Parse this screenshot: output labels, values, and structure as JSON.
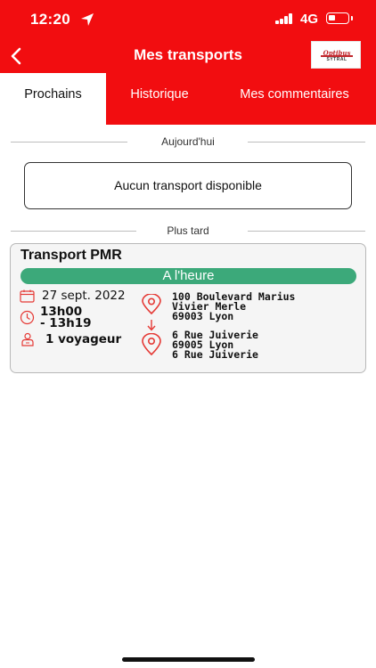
{
  "status_bar": {
    "time": "12:20",
    "network": "4G",
    "battery_level": 0.35,
    "location_icon": "location-arrow-icon",
    "signal_icon": "signal-bars-icon",
    "battery_icon": "battery-icon"
  },
  "header": {
    "title": "Mes transports",
    "back_icon": "chevron-left-icon",
    "logo_text": "Optibus",
    "logo_subtext": "SYTRAL"
  },
  "tabs": [
    {
      "label": "Prochains",
      "active": true
    },
    {
      "label": "Historique",
      "active": false
    },
    {
      "label": "Mes commentaires",
      "active": false
    }
  ],
  "sections": {
    "today_label": "Aujourd'hui",
    "empty_message": "Aucun transport disponible",
    "later_label": "Plus tard"
  },
  "transport": {
    "title": "Transport PMR",
    "status": "A l'heure",
    "date": "27 sept. 2022",
    "time_start": "13h00",
    "time_end": "- 13h19",
    "passengers": "1 voyageur",
    "origin": {
      "line1": "100 Boulevard Marius",
      "line2": "Vivier Merle",
      "line3": "69003 Lyon"
    },
    "destination": {
      "line1": "6 Rue Juiverie",
      "line2": "69005 Lyon",
      "line3": "6 Rue Juiverie"
    }
  },
  "colors": {
    "brand_red": "#f20d10",
    "status_green": "#3ca97a",
    "card_bg": "#f5f5f5"
  }
}
